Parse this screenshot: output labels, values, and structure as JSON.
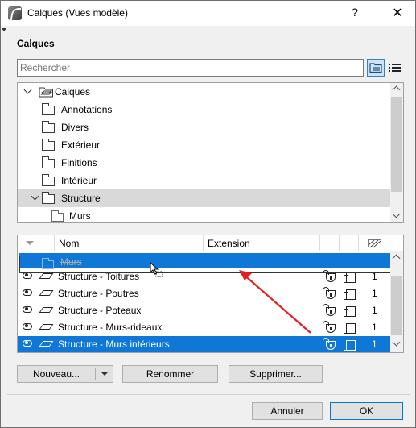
{
  "window": {
    "title": "Calques (Vues modèle)",
    "help_label": "?",
    "close_label": "✕"
  },
  "section_title": "Calques",
  "search": {
    "placeholder": "Rechercher",
    "value": ""
  },
  "tree": {
    "items": [
      {
        "label": "Calques",
        "expanded": true,
        "selected": false,
        "level": 0
      },
      {
        "label": "Annotations",
        "expanded": false,
        "selected": false,
        "level": 1
      },
      {
        "label": "Divers",
        "expanded": false,
        "selected": false,
        "level": 1
      },
      {
        "label": "Extérieur",
        "expanded": false,
        "selected": false,
        "level": 1
      },
      {
        "label": "Finitions",
        "expanded": false,
        "selected": false,
        "level": 1
      },
      {
        "label": "Intérieur",
        "expanded": false,
        "selected": false,
        "level": 1
      },
      {
        "label": "Structure",
        "expanded": true,
        "selected": true,
        "level": 1
      },
      {
        "label": "Murs",
        "expanded": false,
        "selected": false,
        "level": 2
      }
    ]
  },
  "list": {
    "columns": {
      "name": "Nom",
      "extension": "Extension"
    },
    "dragged_item": "Murs",
    "rows": [
      {
        "name": "Structure - Toitures",
        "number": "1",
        "selected": false
      },
      {
        "name": "Structure - Poutres",
        "number": "1",
        "selected": false
      },
      {
        "name": "Structure - Poteaux",
        "number": "1",
        "selected": false
      },
      {
        "name": "Structure - Murs-rideaux",
        "number": "1",
        "selected": false
      },
      {
        "name": "Structure - Murs intérieurs",
        "number": "1",
        "selected": true
      }
    ]
  },
  "buttons": {
    "new": "Nouveau...",
    "rename": "Renommer",
    "delete": "Supprimer...",
    "cancel": "Annuler",
    "ok": "OK"
  },
  "colors": {
    "selection": "#0f78d7",
    "tree_selection": "#d9d9d9",
    "annotation_arrow": "#e81e1e"
  }
}
